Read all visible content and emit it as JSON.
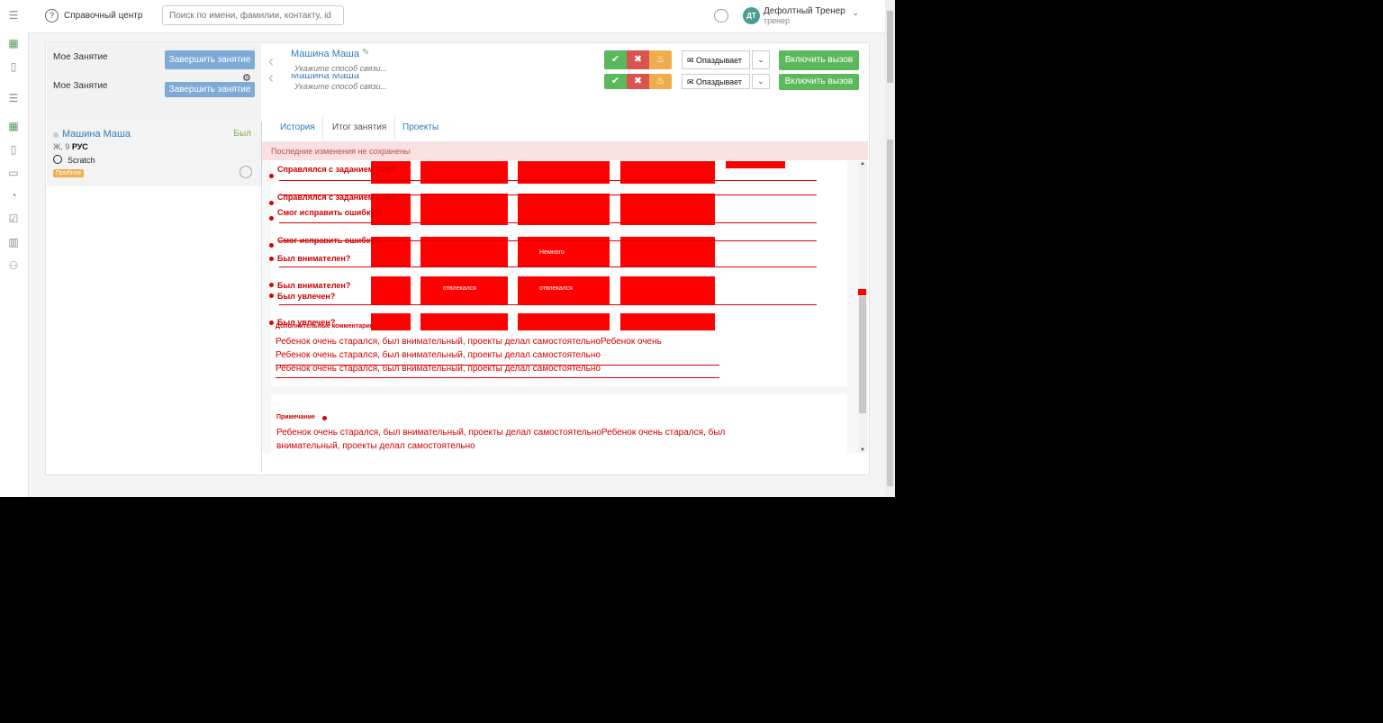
{
  "topbar": {
    "help_icon": "?",
    "help_label": "Справочный центр",
    "search_placeholder": "Поиск по имени, фамилии, контакту, id",
    "user_initials": "ДТ",
    "user_name": "Дефолтный Тренер",
    "user_role": "тренер"
  },
  "lesson": {
    "title": "Мое Занятие",
    "finish_button": "Завершить занятие"
  },
  "student": {
    "name": "Машина Маша",
    "status": "Был",
    "info_prefix": "Ж, 9 ",
    "info_lang": "РУС",
    "course": "Scratch",
    "badge": "Пробное"
  },
  "contact_bar": {
    "name": "Машина Маша",
    "hint": "Укажите способ связи...",
    "late_button": "✉ Опаздывает",
    "call_button": "Включить вызов"
  },
  "tabs": [
    {
      "label": "История"
    },
    {
      "label": "Итог занятия"
    },
    {
      "label": "Проекты"
    }
  ],
  "warning": "Последние изменения не сохранены",
  "assessment": {
    "questions": [
      "Справлялся с заданием сам?",
      "Смог исправить ошибку?",
      "Был внимателен?",
      "Был увлечен?"
    ],
    "options": [
      "отвлекался",
      "Немного"
    ],
    "comment_label": "Дополнительные комментарии",
    "comment_text": "Ребенок очень старался, был внимательный, проекты делал самостоятельно",
    "comment_text_2": "Ребенок очень старался, был внимательный, проекты делал самостоятельноРебенок очень"
  },
  "note": {
    "label": "Примечание",
    "text": "Ребенок очень старался, был внимательный, проекты делал самостоятельноРебенок очень старался, был",
    "text_2": "внимательный, проекты делал самостоятельно"
  },
  "colors": {
    "accent": "#337ab7",
    "success": "#5cb85c",
    "danger": "#d9534f",
    "warning": "#f0ad4e",
    "finish_button": "#7eaad6",
    "debug_overlay": "#ff0000"
  }
}
